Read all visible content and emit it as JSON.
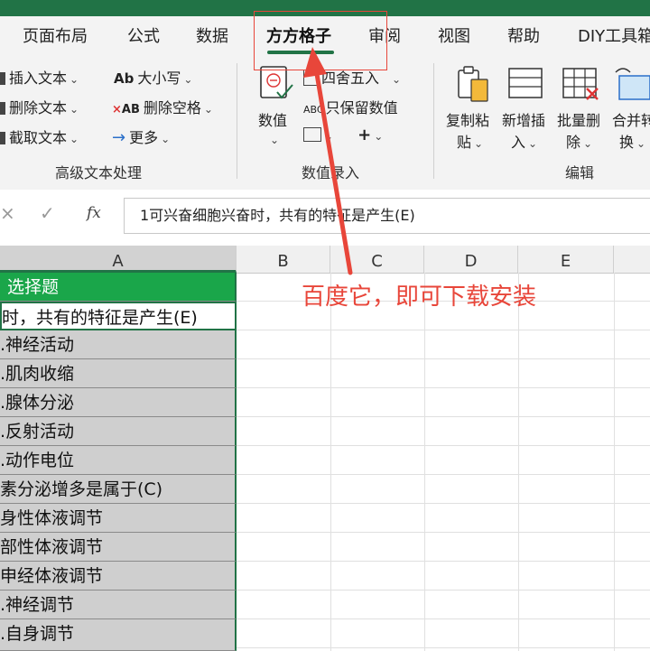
{
  "tabs": [
    {
      "label": "页面布局"
    },
    {
      "label": "公式"
    },
    {
      "label": "数据"
    },
    {
      "label": "方方格子"
    },
    {
      "label": "审阅"
    },
    {
      "label": "视图"
    },
    {
      "label": "帮助"
    },
    {
      "label": "DIY工具箱"
    }
  ],
  "ribbon": {
    "text_group": {
      "insert_text": "插入文本",
      "delete_text": "删除文本",
      "extract_text": "截取文本",
      "case": "大小写",
      "delete_spaces": "删除空格",
      "more": "更多",
      "label": "高级文本处理"
    },
    "number_group": {
      "value": "数值",
      "round": "四舍五入",
      "keep_numbers": "只保留数值",
      "label": "数值录入"
    },
    "edit_group": {
      "copy_paste_1": "复制粘",
      "copy_paste_2": "贴",
      "insert_new_1": "新增插",
      "insert_new_2": "入",
      "batch_delete_1": "批量删",
      "batch_delete_2": "除",
      "merge_1": "合并转",
      "merge_2": "换",
      "label": "编辑"
    }
  },
  "formula_bar": {
    "fx": "fx",
    "value": "1可兴奋细胞兴奋时，共有的特征是产生(E)"
  },
  "columns": [
    "A",
    "B",
    "C",
    "D",
    "E"
  ],
  "cells": [
    "选择题",
    "时，共有的特征是产生(E)",
    ".神经活动",
    ".肌肉收缩",
    ".腺体分泌",
    ".反射活动",
    ".动作电位",
    "素分泌增多是属于(C)",
    "身性体液调节",
    "部性体液调节",
    "申经体液调节",
    ".神经调节",
    ".自身调节"
  ],
  "annotation": "百度它，即可下载安装",
  "colors": {
    "brand": "#217346",
    "header_fill": "#1aa64a",
    "annotation": "#e8463a"
  }
}
